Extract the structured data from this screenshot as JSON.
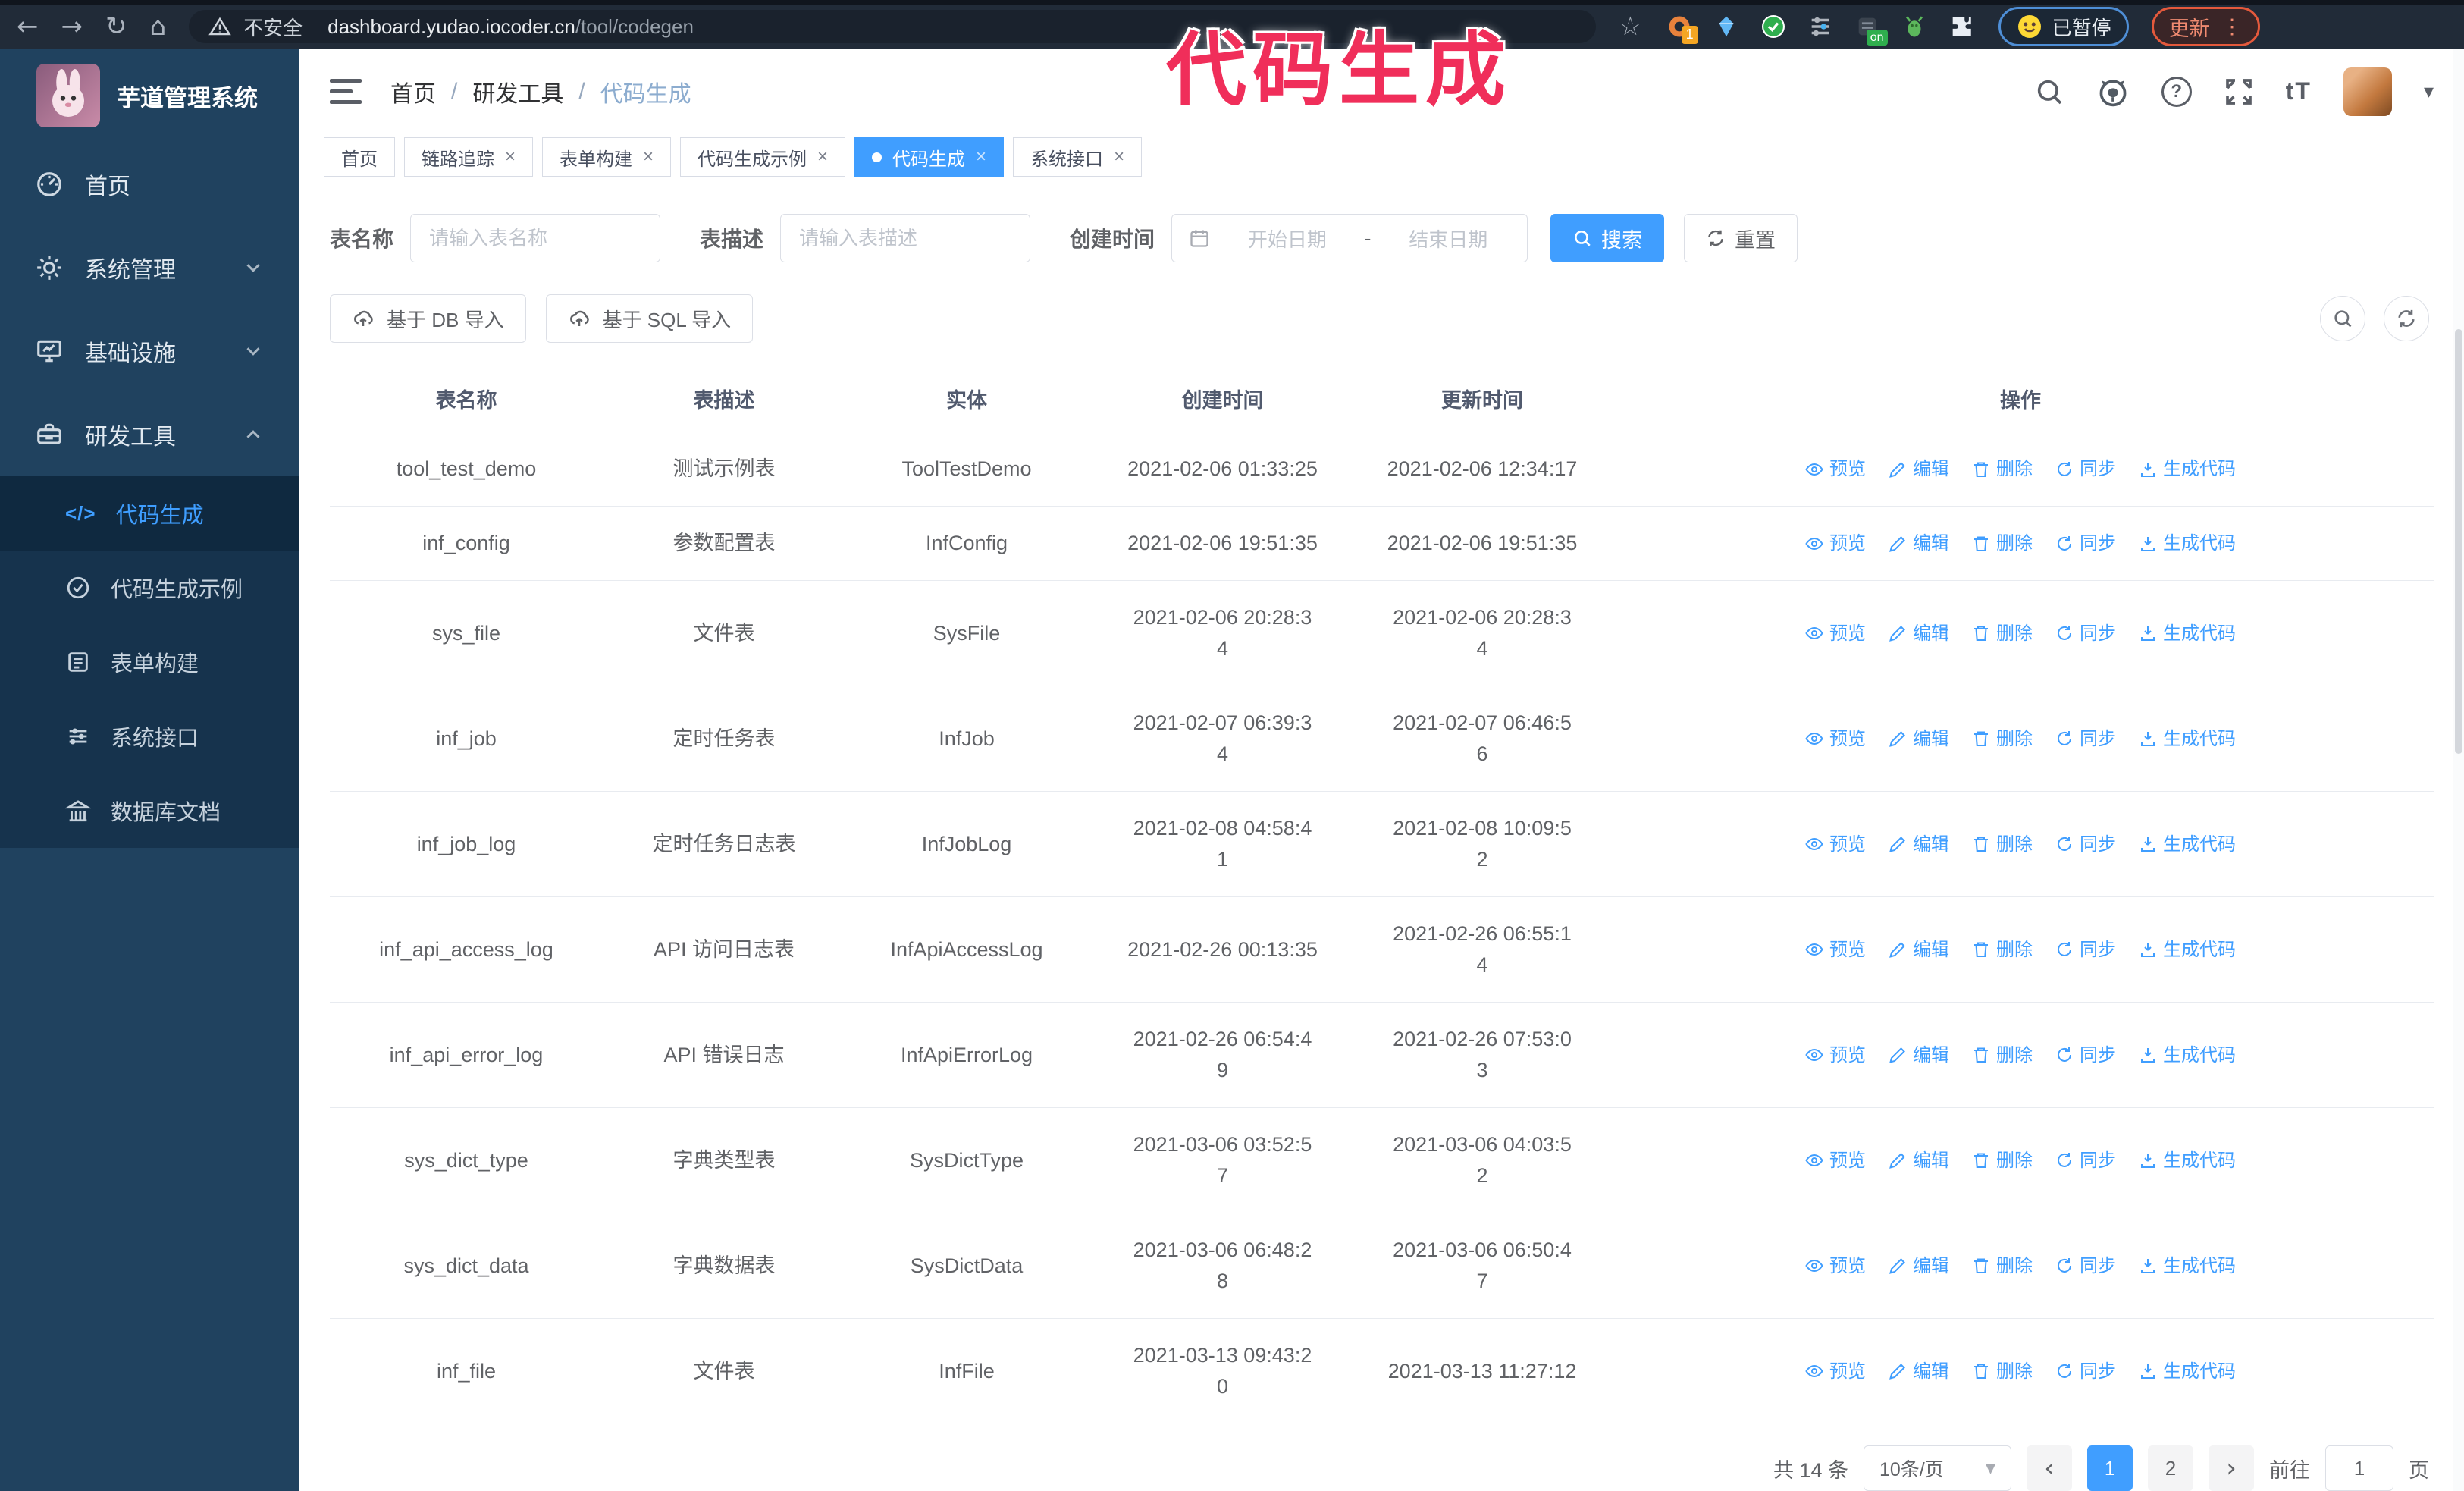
{
  "colors": {
    "accent": "#409eff",
    "sidebar": "#20425f",
    "submenu": "#16334d",
    "annotation": "#f02e5a",
    "update_orange": "#e4593c",
    "paused_blue": "#4e8ed6",
    "browser_bar": "#212b38"
  },
  "browser": {
    "security_label": "不安全",
    "url_host": "dashboard.yudao.iocoder.cn",
    "url_path": "/tool/codegen",
    "ext_badge": "1",
    "ext_on_badge": "on",
    "paused_label": "已暂停",
    "update_label": "更新"
  },
  "overlay": {
    "annotation": "代码生成"
  },
  "sidebar": {
    "logo_title": "芋道管理系统",
    "items": [
      {
        "label": "首页"
      },
      {
        "label": "系统管理"
      },
      {
        "label": "基础设施"
      },
      {
        "label": "研发工具"
      }
    ],
    "subitems": [
      {
        "label": "代码生成"
      },
      {
        "label": "代码生成示例"
      },
      {
        "label": "表单构建"
      },
      {
        "label": "系统接口"
      },
      {
        "label": "数据库文档"
      }
    ]
  },
  "header": {
    "breadcrumb": [
      "首页",
      "研发工具",
      "代码生成"
    ]
  },
  "tabs": [
    {
      "label": "首页"
    },
    {
      "label": "链路追踪"
    },
    {
      "label": "表单构建"
    },
    {
      "label": "代码生成示例"
    },
    {
      "label": "代码生成"
    },
    {
      "label": "系统接口"
    }
  ],
  "filters": {
    "table_name_label": "表名称",
    "table_name_placeholder": "请输入表名称",
    "table_desc_label": "表描述",
    "table_desc_placeholder": "请输入表描述",
    "create_time_label": "创建时间",
    "start_date_placeholder": "开始日期",
    "range_separator": "-",
    "end_date_placeholder": "结束日期",
    "search_button": "搜索",
    "reset_button": "重置"
  },
  "toolbar": {
    "import_db": "基于 DB 导入",
    "import_sql": "基于 SQL 导入"
  },
  "table": {
    "columns": [
      "表名称",
      "表描述",
      "实体",
      "创建时间",
      "更新时间",
      "操作"
    ],
    "actions": [
      "预览",
      "编辑",
      "删除",
      "同步",
      "生成代码"
    ],
    "rows": [
      {
        "name": "tool_test_demo",
        "desc": "测试示例表",
        "entity": "ToolTestDemo",
        "created": "2021-02-06 01:33:25",
        "updated": "2021-02-06 12:34:17"
      },
      {
        "name": "inf_config",
        "desc": "参数配置表",
        "entity": "InfConfig",
        "created": "2021-02-06 19:51:35",
        "updated": "2021-02-06 19:51:35"
      },
      {
        "name": "sys_file",
        "desc": "文件表",
        "entity": "SysFile",
        "created": "2021-02-06 20:28:3\n4",
        "updated": "2021-02-06 20:28:3\n4"
      },
      {
        "name": "inf_job",
        "desc": "定时任务表",
        "entity": "InfJob",
        "created": "2021-02-07 06:39:3\n4",
        "updated": "2021-02-07 06:46:5\n6"
      },
      {
        "name": "inf_job_log",
        "desc": "定时任务日志表",
        "entity": "InfJobLog",
        "created": "2021-02-08 04:58:4\n1",
        "updated": "2021-02-08 10:09:5\n2"
      },
      {
        "name": "inf_api_access_log",
        "desc": "API 访问日志表",
        "entity": "InfApiAccessLog",
        "created": "2021-02-26 00:13:35",
        "updated": "2021-02-26 06:55:1\n4"
      },
      {
        "name": "inf_api_error_log",
        "desc": "API 错误日志",
        "entity": "InfApiErrorLog",
        "created": "2021-02-26 06:54:4\n9",
        "updated": "2021-02-26 07:53:0\n3"
      },
      {
        "name": "sys_dict_type",
        "desc": "字典类型表",
        "entity": "SysDictType",
        "created": "2021-03-06 03:52:5\n7",
        "updated": "2021-03-06 04:03:5\n2"
      },
      {
        "name": "sys_dict_data",
        "desc": "字典数据表",
        "entity": "SysDictData",
        "created": "2021-03-06 06:48:2\n8",
        "updated": "2021-03-06 06:50:4\n7"
      },
      {
        "name": "inf_file",
        "desc": "文件表",
        "entity": "InfFile",
        "created": "2021-03-13 09:43:2\n0",
        "updated": "2021-03-13 11:27:12"
      }
    ]
  },
  "pagination": {
    "total": "共 14 条",
    "page_size": "10条/页",
    "pages": [
      "1",
      "2"
    ],
    "goto_label": "前往",
    "goto_value": "1",
    "goto_suffix": "页"
  }
}
